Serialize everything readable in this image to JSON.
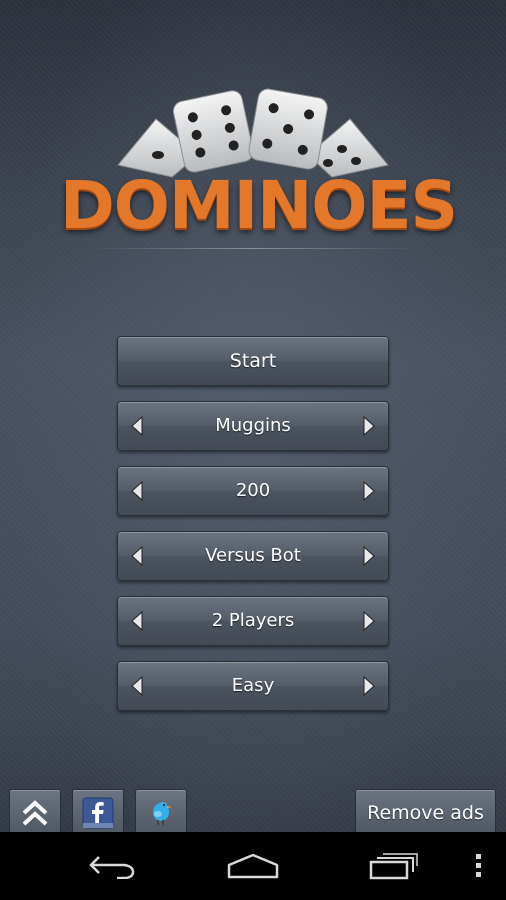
{
  "logo": {
    "title": "DOMINOES"
  },
  "menu": {
    "start_label": "Start",
    "selectors": [
      {
        "value": "Muggins"
      },
      {
        "value": "200"
      },
      {
        "value": "Versus Bot"
      },
      {
        "value": "2 Players"
      },
      {
        "value": "Easy"
      }
    ]
  },
  "bottom": {
    "icons": [
      "double-chevron-up-icon",
      "facebook-icon",
      "twitter-bird-icon"
    ],
    "remove_ads_label": "Remove ads"
  },
  "navbar": {
    "icons": [
      "back-icon",
      "home-icon",
      "recent-apps-icon",
      "overflow-menu-icon"
    ]
  },
  "colors": {
    "logo_orange": "#e3782a",
    "button_top": "#6b7480",
    "button_bottom": "#434a54",
    "background": "#3a4350"
  }
}
